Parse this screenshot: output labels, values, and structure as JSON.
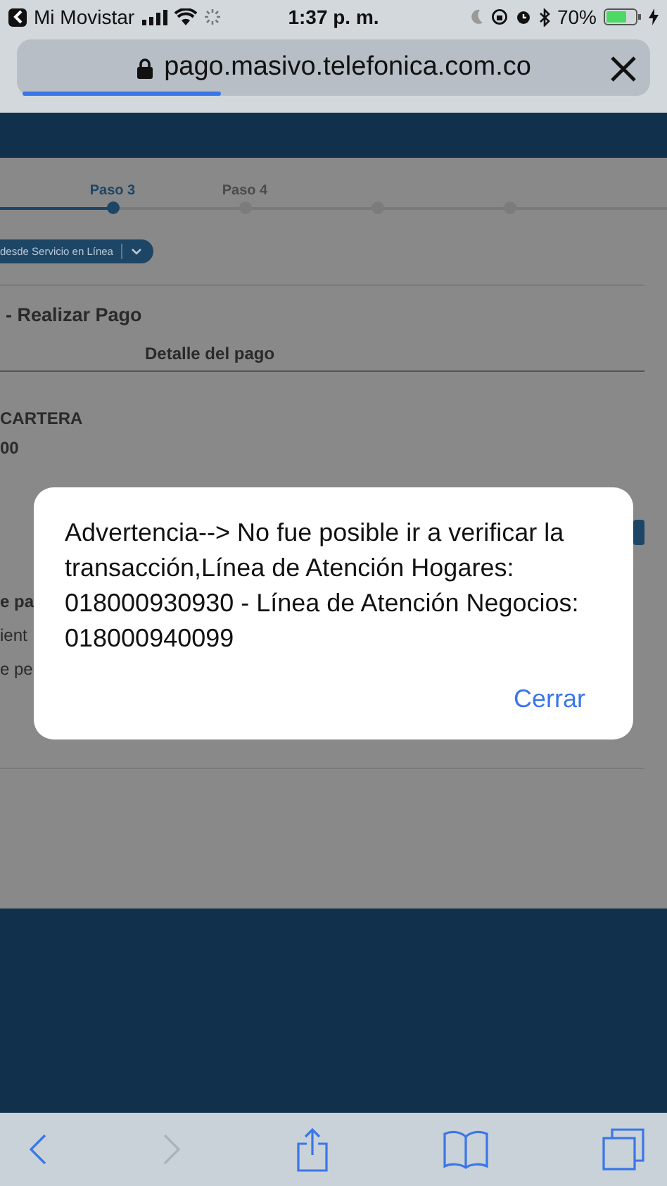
{
  "status_bar": {
    "back_app": "Mi Movistar",
    "time": "1:37 p. m.",
    "battery": "70%"
  },
  "address_bar": {
    "url": "pago.masivo.telefonica.com.co",
    "level": 0.32
  },
  "page": {
    "steps": [
      {
        "label": "Paso 3",
        "selected": true
      },
      {
        "label": "Paso 4",
        "selected": false
      },
      {
        "selected": false
      },
      {
        "selected": false
      }
    ],
    "service_dropdown": "desde Servicio en Línea",
    "heading": "- Realizar Pago",
    "section_title": "Detalle del pago",
    "lines": [
      {
        "text": "CARTERA",
        "kind": "bold"
      },
      {
        "text": "00",
        "kind": "bold"
      }
    ],
    "cut_texts": [
      {
        "text": "e pa",
        "kind": "bold"
      },
      {
        "text": "ient",
        "kind": "plain"
      },
      {
        "text": "e pe",
        "kind": "plain"
      }
    ]
  },
  "dialog": {
    "message": "Advertencia--> No fue posible ir a verificar la transacción,Línea de Atención Hogares: 018000930930 - Línea de Atención Negocios: 018000940099",
    "button": "Cerrar"
  },
  "toolbar": {
    "back_disabled": false,
    "forward_disabled": true
  }
}
